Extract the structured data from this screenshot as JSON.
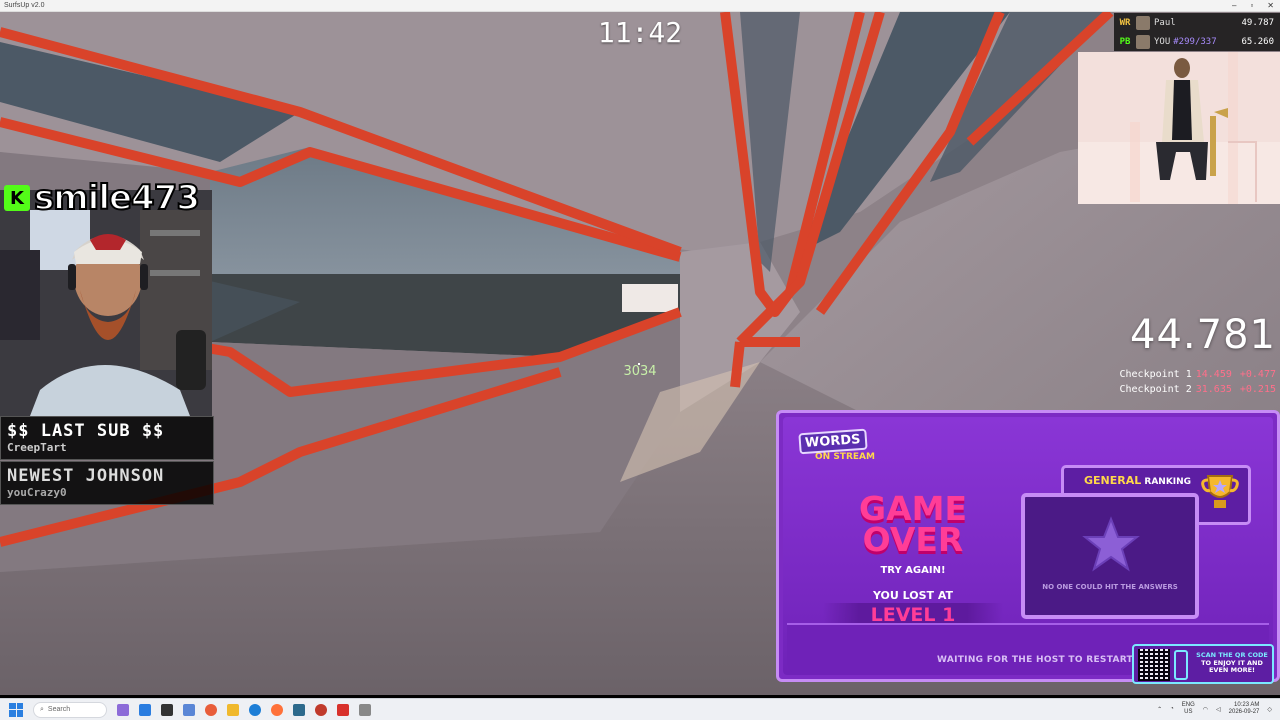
{
  "window": {
    "title": "SurfsUp v2.0",
    "controls": [
      "–",
      "▫",
      "✕"
    ]
  },
  "hud": {
    "timer": "11:42",
    "speed": "3034",
    "run_time": "44.781",
    "checkpoints": [
      {
        "label": "Checkpoint 1",
        "time": "14.459",
        "delta": "+0.477"
      },
      {
        "label": "Checkpoint 2",
        "time": "31.635",
        "delta": "+0.215"
      }
    ]
  },
  "leaderboard": {
    "rows": [
      {
        "tag": "WR",
        "name": "Paul",
        "rank": "",
        "time": "49.787",
        "tag_color": "#f5c542"
      },
      {
        "tag": "PB",
        "name": "YOU",
        "rank": "#299/337",
        "time": "65.260",
        "tag_color": "#53fc18"
      }
    ]
  },
  "stream": {
    "kick_logo": "K",
    "handle": "smile473",
    "last_sub": {
      "header": "$$ LAST SUB $$",
      "value": "CreepTart"
    },
    "newest": {
      "header": "NEWEST JOHNSON",
      "value": "youCrazy0"
    }
  },
  "words_on_stream": {
    "logo_top": "WORDS",
    "logo_bottom": "ON STREAM",
    "game_over": "GAME OVER",
    "try_again": "TRY AGAIN!",
    "lost_at": "YOU LOST AT",
    "level": "LEVEL 1",
    "ranking_strong": "GENERAL",
    "ranking_rest": " RANKING",
    "no_hit": "NO ONE COULD HIT THE ANSWERS",
    "waiting": "WAITING FOR THE HOST TO RESTART",
    "qr_text_a": "SCAN THE QR CODE",
    "qr_text_b": " TO ENJOY IT AND EVEN MORE!"
  },
  "taskbar": {
    "search_placeholder": "Search",
    "tray_lang": "ENG",
    "tray_region": "US",
    "time": "10:23 AM",
    "date": "2026-09-27"
  },
  "colors": {
    "accent_red": "#d9432a",
    "wall": "#9b8f95",
    "kick_green": "#53fc18",
    "wos_purple": "#7c2bc4",
    "wos_pink": "#ff3d97"
  }
}
